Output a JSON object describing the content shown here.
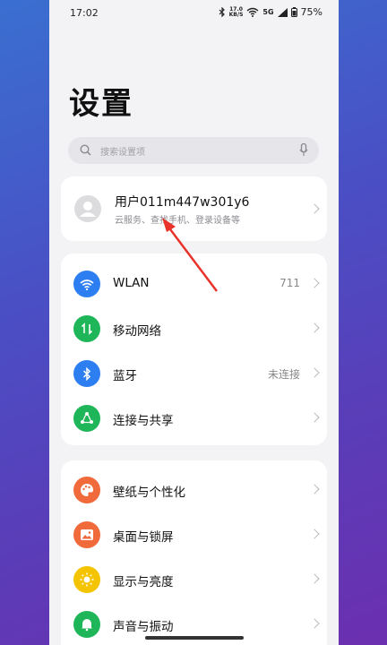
{
  "status": {
    "time": "17:02",
    "net_speed_top": "17.0",
    "net_speed_bottom": "KB/S",
    "signal": "5G",
    "battery": "75%"
  },
  "page": {
    "title": "设置"
  },
  "search": {
    "placeholder": "搜索设置项"
  },
  "account": {
    "name": "用户011m447w301y6",
    "subtitle": "云服务、查找手机、登录设备等"
  },
  "group1": [
    {
      "label": "WLAN",
      "value": "711",
      "icon": "wifi-icon",
      "color": "#2d7ef0"
    },
    {
      "label": "移动网络",
      "value": "",
      "icon": "mobile-data-icon",
      "color": "#1fb65a"
    },
    {
      "label": "蓝牙",
      "value": "未连接",
      "icon": "bluetooth-icon",
      "color": "#2d7ef0"
    },
    {
      "label": "连接与共享",
      "value": "",
      "icon": "share-icon",
      "color": "#1fb65a"
    }
  ],
  "group2": [
    {
      "label": "壁纸与个性化",
      "icon": "palette-icon",
      "color": "#f06a3c"
    },
    {
      "label": "桌面与锁屏",
      "icon": "picture-icon",
      "color": "#f06a3c"
    },
    {
      "label": "显示与亮度",
      "icon": "sun-icon",
      "color": "#f5c400"
    },
    {
      "label": "声音与振动",
      "icon": "bell-icon",
      "color": "#1fb65a"
    }
  ]
}
